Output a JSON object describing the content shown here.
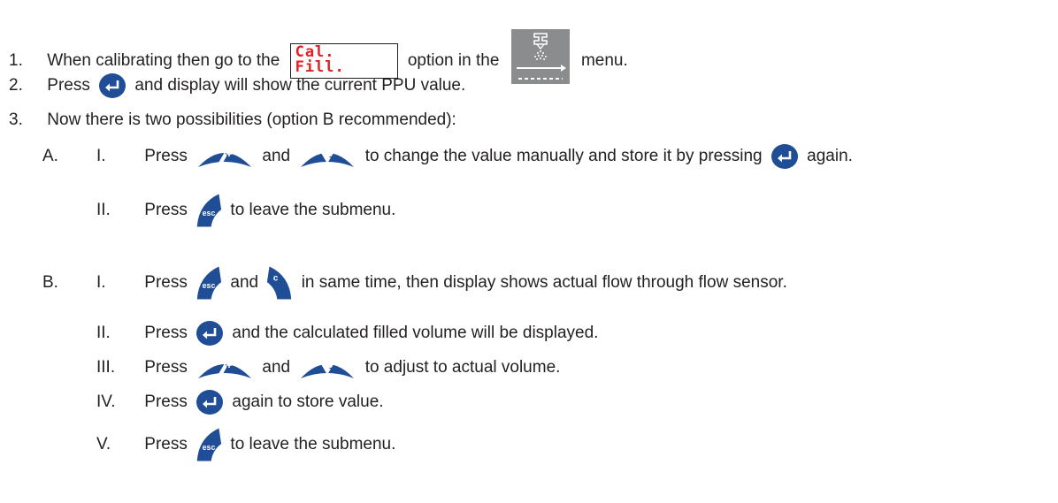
{
  "colors": {
    "text": "#231f20",
    "key_blue": "#1f4e96",
    "lcd_red": "#e31e24",
    "menu_grey": "#8a8c8e"
  },
  "icons": {
    "enter": "enter-key-icon",
    "up": "up-plus-key-icon",
    "down": "down-minus-key-icon",
    "esc": "esc-key-icon",
    "c": "c-key-icon",
    "lcd": "lcd-cal-fill-display-icon",
    "menu": "spray-nozzle-menu-icon"
  },
  "lcd": {
    "line1": "Cal.",
    "line2": "Fill."
  },
  "steps": [
    {
      "num": "1.",
      "t1": "When calibrating then go to the",
      "t2": "option in the",
      "t3": "menu."
    },
    {
      "num": "2.",
      "t1": "Press",
      "t2": "and display will show the current PPU value."
    },
    {
      "num": "3.",
      "t1": "Now there is two possibilities (option B recommended):"
    }
  ],
  "option_a": {
    "label": "A.",
    "items": [
      {
        "num": "I.",
        "t1": "Press",
        "t2": "and",
        "t3": "to change the value manually and store it by pressing",
        "t4": "again."
      },
      {
        "num": "II.",
        "t1": "Press",
        "t2": "to leave the submenu."
      }
    ]
  },
  "option_b": {
    "label": "B.",
    "items": [
      {
        "num": "I.",
        "t1": "Press",
        "t2": "and",
        "t3": "in same time, then display shows actual flow through flow sensor."
      },
      {
        "num": "II.",
        "t1": "Press",
        "t2": "and the calculated filled volume will be displayed."
      },
      {
        "num": "III.",
        "t1": "Press",
        "t2": "and",
        "t3": "to adjust to actual volume."
      },
      {
        "num": "IV.",
        "t1": "Press",
        "t2": "again to store value."
      },
      {
        "num": "V.",
        "t1": "Press",
        "t2": "to leave the submenu."
      }
    ]
  }
}
